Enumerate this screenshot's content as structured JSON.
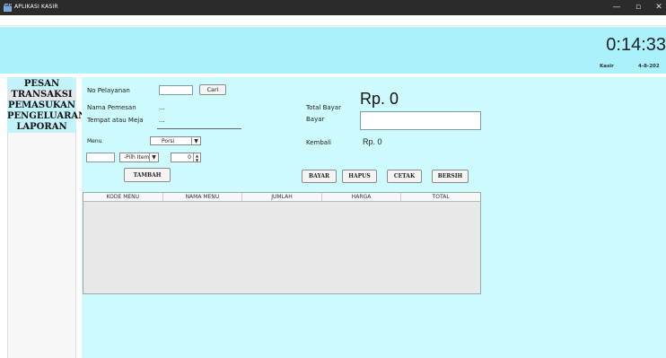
{
  "window": {
    "title": "APLIKASI KASIR",
    "controls": {
      "minimize": "—",
      "maximize": "▫",
      "close": "✕"
    }
  },
  "menubar": {
    "kasir": "Kasir"
  },
  "header": {
    "clock": "0:14:33",
    "user": "Kasir",
    "date": "4-8-202"
  },
  "sidebar": {
    "items": [
      {
        "label": "PESAN"
      },
      {
        "label": "TRANSAKSI"
      },
      {
        "label": "PEMASUKAN"
      },
      {
        "label": "PENGELUARAN"
      },
      {
        "label": "LAPORAN"
      }
    ]
  },
  "form": {
    "no_pelayanan_label": "No Pelayanan",
    "no_pelayanan_value": "",
    "cari_button": "Cari",
    "nama_pemesan_label": "Nama Pemesan",
    "nama_pemesan_value": "...",
    "tempat_label": "Tempat atau Meja",
    "tempat_value": "...",
    "menu_label": "Menu",
    "porsi_select": "Porsi",
    "menu_input": "",
    "pilih_item_select": "-Pilh Item-",
    "qty_value": "0",
    "tambah_button": "TAMBAH"
  },
  "payment": {
    "total_bayar_label": "Total Bayar",
    "total_value": "Rp. 0",
    "bayar_label": "Bayar",
    "bayar_input": "",
    "kembali_label": "Kembali",
    "kembali_value": "Rp. 0",
    "buttons": {
      "bayar": "BAYAR",
      "hapus": "HAPUS",
      "cetak": "CETAK",
      "bersih": "BERSIH"
    }
  },
  "table": {
    "columns": [
      "KODE MENU",
      "NAMA MENU",
      "JUMLAH",
      "HARGA",
      "TOTAL"
    ],
    "rows": []
  },
  "colors": {
    "header_bg": "#aaf1fb",
    "main_bg": "#ccfafd",
    "nav_bg": "#c2f3fb",
    "titlebar": "#2b2b2b"
  }
}
